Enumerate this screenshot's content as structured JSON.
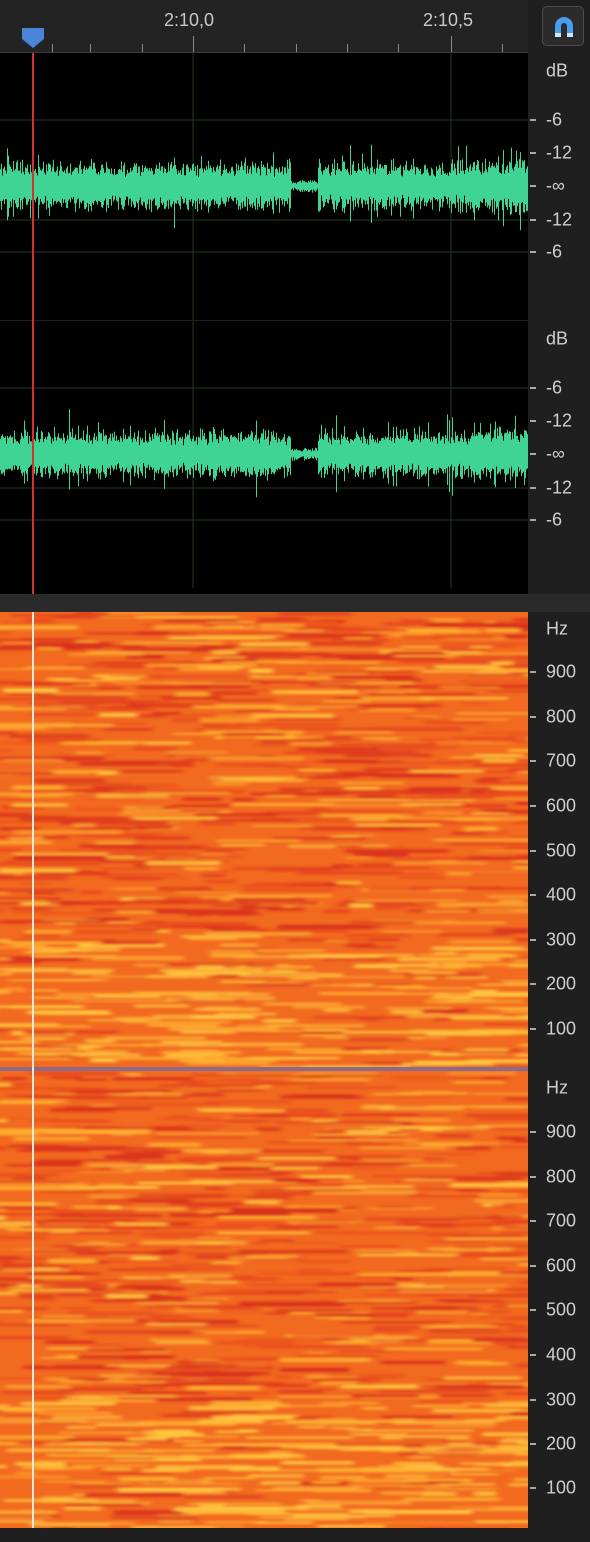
{
  "ruler": {
    "time_labels": [
      "2:10,0",
      "2:10,5"
    ]
  },
  "toolbar": {
    "snap_icon": "magnet-icon"
  },
  "waveform_channels": [
    {
      "scale_unit": "dB",
      "scale_labels": [
        "-6",
        "-12",
        "-∞",
        "-12",
        "-6"
      ]
    },
    {
      "scale_unit": "dB",
      "scale_labels": [
        "-6",
        "-12",
        "-∞",
        "-12",
        "-6"
      ]
    }
  ],
  "spectral_channels": [
    {
      "scale_unit": "Hz",
      "scale_labels": [
        "900",
        "800",
        "700",
        "600",
        "500",
        "400",
        "300",
        "200",
        "100"
      ]
    },
    {
      "scale_unit": "Hz",
      "scale_labels": [
        "900",
        "800",
        "700",
        "600",
        "500",
        "400",
        "300",
        "200",
        "100"
      ]
    }
  ],
  "colors": {
    "waveform": "#3fd394",
    "playhead": "#d2332c",
    "playhead_spectral": "#f0e6e0",
    "playhead_marker": "#4a86d8",
    "spectral_low": "#d8301c",
    "spectral_mid": "#f26a20",
    "spectral_high": "#ffc840"
  }
}
